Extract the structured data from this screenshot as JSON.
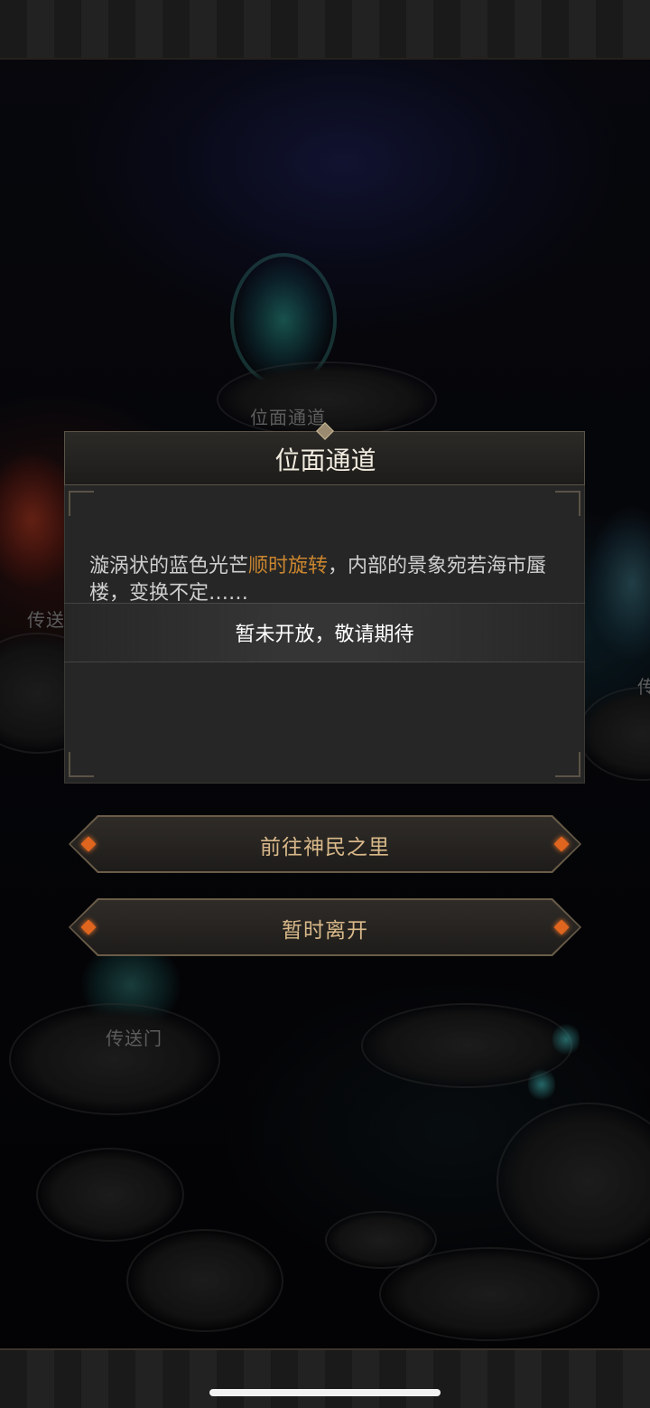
{
  "map": {
    "labels": {
      "top_portal": "位面通道",
      "left_portal": "传送",
      "right_portal": "传",
      "bottom_portal": "传送门"
    }
  },
  "dialog": {
    "title": "位面通道",
    "description_part1": "漩涡状的蓝色光芒",
    "description_highlight": "顺时旋转",
    "description_part2": "，内部的景象宛若海市蜃楼，变换不定……",
    "toast": "暂未开放，敬请期待"
  },
  "buttons": {
    "go": "前往神民之里",
    "leave": "暂时离开"
  },
  "colors": {
    "highlight": "#c9852f",
    "button_text": "#d9b98a",
    "gem": "#e0651e"
  }
}
